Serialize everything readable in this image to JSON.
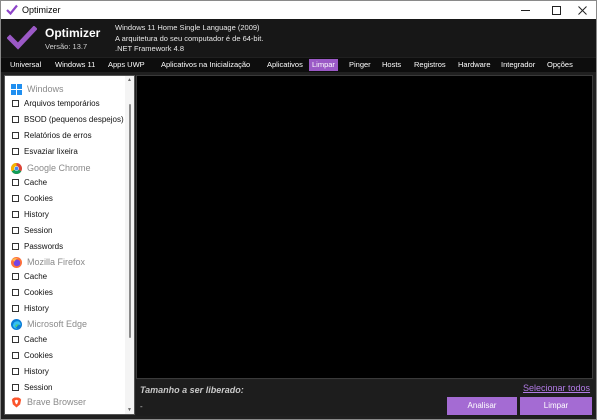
{
  "window": {
    "title": "Optimizer"
  },
  "header": {
    "app_name": "Optimizer",
    "version": "Versão: 13.7",
    "sys_info": [
      "Windows 11 Home Single Language (2009)",
      "A arquitetura do seu computador é de 64-bit.",
      ".NET Framework 4.8"
    ]
  },
  "tabs": [
    {
      "label": "Universal",
      "active": false
    },
    {
      "label": "Windows 11",
      "active": false
    },
    {
      "label": "Apps UWP",
      "active": false
    },
    {
      "label": "Aplicativos na Inicialização",
      "active": false
    },
    {
      "label": "Aplicativos",
      "active": false
    },
    {
      "label": "Limpar",
      "active": true
    },
    {
      "label": "Pinger",
      "active": false
    },
    {
      "label": "Hosts",
      "active": false
    },
    {
      "label": "Registros",
      "active": false
    },
    {
      "label": "Hardware",
      "active": false
    },
    {
      "label": "Integrador",
      "active": false
    },
    {
      "label": "Opções",
      "active": false
    }
  ],
  "groups": [
    {
      "name": "Windows",
      "icon": "windows-icon",
      "items": [
        "Arquivos temporários",
        "BSOD (pequenos despejos)",
        "Relatórios de erros",
        "Esvaziar lixeira"
      ]
    },
    {
      "name": "Google Chrome",
      "icon": "chrome-icon",
      "items": [
        "Cache",
        "Cookies",
        "History",
        "Session",
        "Passwords"
      ]
    },
    {
      "name": "Mozilla Firefox",
      "icon": "firefox-icon",
      "items": [
        "Cache",
        "Cookies",
        "History"
      ]
    },
    {
      "name": "Microsoft Edge",
      "icon": "edge-icon",
      "items": [
        "Cache",
        "Cookies",
        "History",
        "Session"
      ]
    },
    {
      "name": "Brave Browser",
      "icon": "brave-icon",
      "items": []
    }
  ],
  "bottom": {
    "size_label": "Tamanho a ser liberado:",
    "size_value": "-",
    "select_all": "Selecionar todos",
    "analyze_button": "Analisar",
    "clean_button": "Limpar"
  },
  "colors": {
    "accent": "#9b59c6",
    "button": "#a46bd3",
    "link": "#b27be6"
  }
}
